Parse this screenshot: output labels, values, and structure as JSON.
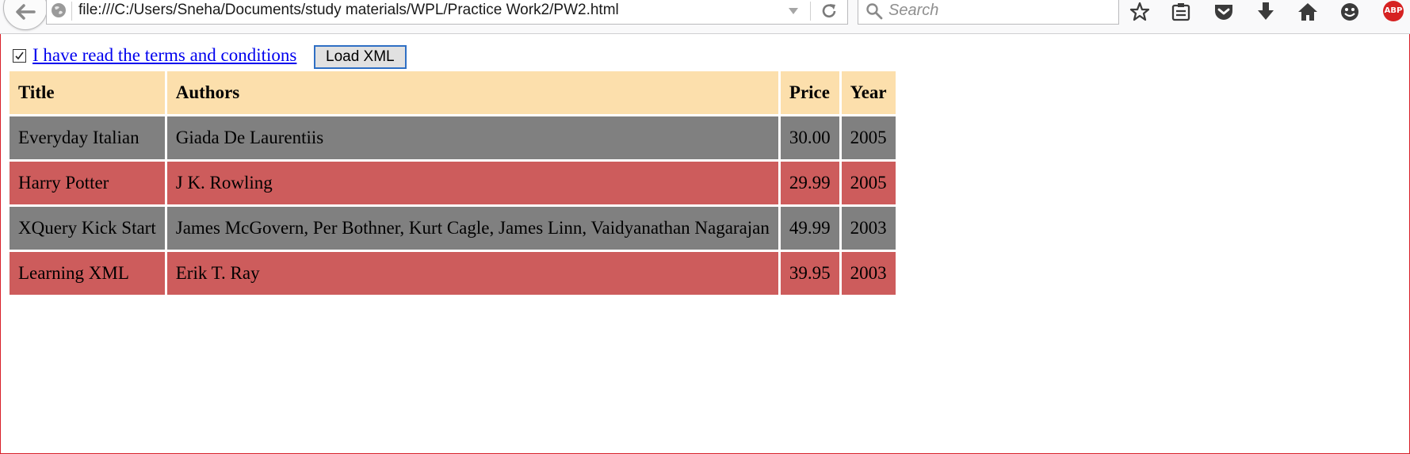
{
  "browser": {
    "url": "file:///C:/Users/Sneha/Documents/study materials/WPL/Practice Work2/PW2.html",
    "search_placeholder": "Search",
    "addon_badge": "ABP"
  },
  "controls": {
    "checkbox_checked": true,
    "terms_link": "I have read the terms and conditions",
    "load_button": "Load XML"
  },
  "table": {
    "headers": [
      "Title",
      "Authors",
      "Price",
      "Year"
    ],
    "rows": [
      {
        "title": "Everyday Italian",
        "authors": "Giada De Laurentiis",
        "price": "30.00",
        "year": "2005"
      },
      {
        "title": "Harry Potter",
        "authors": "J K. Rowling",
        "price": "29.99",
        "year": "2005"
      },
      {
        "title": "XQuery Kick Start",
        "authors": "James McGovern, Per Bothner, Kurt Cagle, James Linn, Vaidyanathan Nagarajan",
        "price": "49.99",
        "year": "2003"
      },
      {
        "title": "Learning XML",
        "authors": "Erik T. Ray",
        "price": "39.95",
        "year": "2003"
      }
    ]
  },
  "colors": {
    "header_bg": "#fcdfac",
    "row_gray": "#808080",
    "row_red": "#cd5c5c",
    "link": "#0000ee"
  }
}
